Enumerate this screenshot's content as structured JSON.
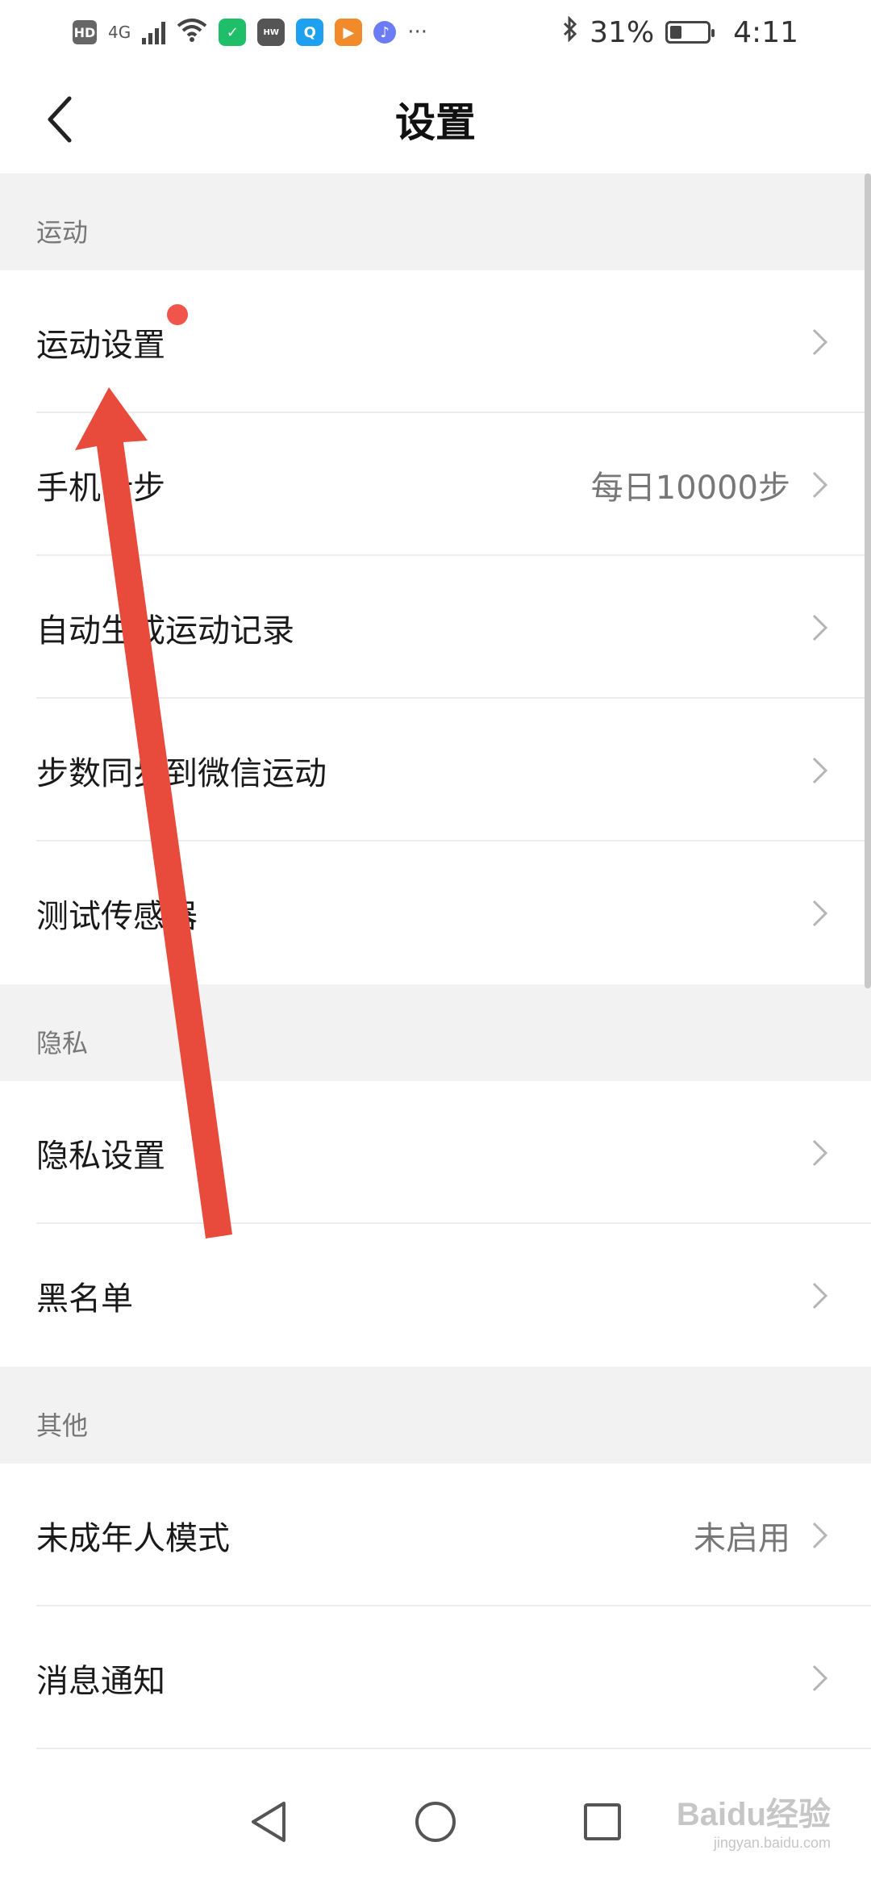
{
  "status_bar": {
    "network": "4G",
    "battery": "31%",
    "battery_level": 0.31,
    "time": "4:11",
    "more": "···",
    "icons": [
      "hd-icon",
      "signal-icon",
      "wifi-icon",
      "app-icon-green",
      "huawei-icon",
      "search-app-icon",
      "video-app-icon",
      "music-app-icon",
      "bluetooth-icon",
      "battery-icon"
    ]
  },
  "nav": {
    "title": "设置"
  },
  "sections": [
    {
      "header": "运动",
      "items": [
        {
          "label": "运动设置",
          "value": "",
          "badge": true
        },
        {
          "label": "手机计步",
          "value": "每日10000步",
          "badge": false
        },
        {
          "label": "自动生成运动记录",
          "value": "",
          "badge": false
        },
        {
          "label": "步数同步到微信运动",
          "value": "",
          "badge": false
        },
        {
          "label": "测试传感器",
          "value": "",
          "badge": false
        }
      ]
    },
    {
      "header": "隐私",
      "items": [
        {
          "label": "隐私设置",
          "value": "",
          "badge": false
        },
        {
          "label": "黑名单",
          "value": "",
          "badge": false
        }
      ]
    },
    {
      "header": "其他",
      "items": [
        {
          "label": "未成年人模式",
          "value": "未启用",
          "badge": false
        },
        {
          "label": "消息通知",
          "value": "",
          "badge": false
        }
      ]
    }
  ],
  "colors": {
    "badge": "#f0544a",
    "annotation_arrow": "#e84a3c",
    "section_bg": "#f2f2f2"
  },
  "watermark": {
    "brand": "Baidu经验",
    "url": "jingyan.baidu.com"
  }
}
